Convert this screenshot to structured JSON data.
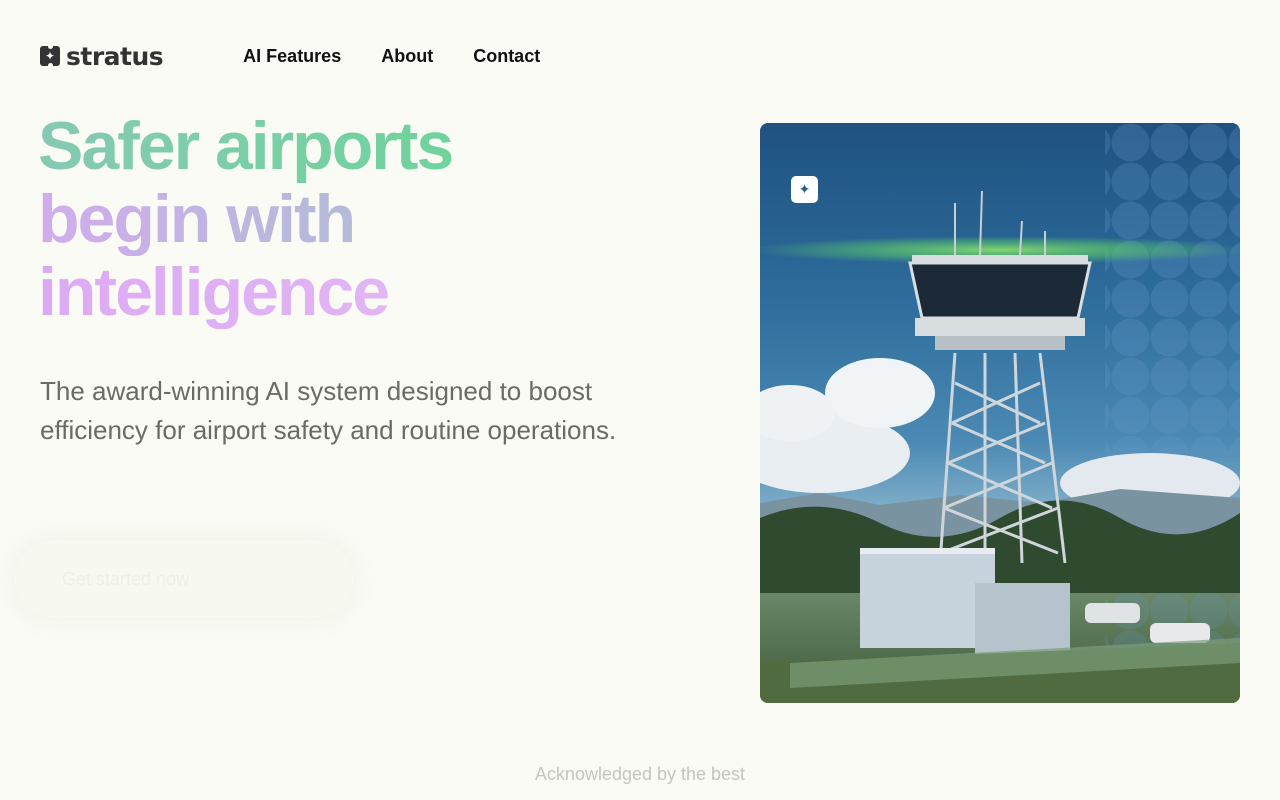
{
  "header": {
    "logo_text": "stratus",
    "logo_icon": "sparkle-logo-icon",
    "nav": [
      {
        "label": "AI Features"
      },
      {
        "label": "About"
      },
      {
        "label": "Contact"
      }
    ]
  },
  "hero": {
    "title_lines": [
      "Safer airports",
      "begin with",
      "intelligence"
    ],
    "subtitle": "The award-winning AI system designed to boost efficiency for airport safety and routine operations.",
    "cta_label": "Get started now"
  },
  "image_card": {
    "alt": "airport control tower",
    "badge_icon": "sparkle-logo-icon"
  },
  "footer": {
    "acknowledged": "Acknowledged by the best"
  },
  "colors": {
    "background": "#fbfbf6",
    "title_green": "#6fd39c",
    "title_purple": "#d2acee",
    "subtitle_gray": "#6b6b66"
  }
}
